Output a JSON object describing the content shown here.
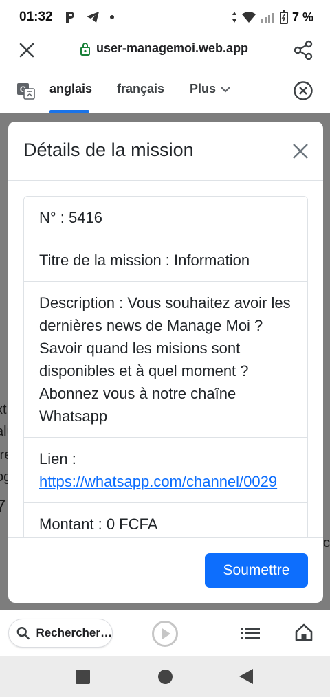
{
  "status": {
    "time": "01:32",
    "battery": "7 %"
  },
  "browser": {
    "url": "user-managemoi.web.app"
  },
  "translate": {
    "lang_active": "anglais",
    "lang_second": "français",
    "more": "Plus"
  },
  "background": {
    "fragments": [
      "xt",
      "alu",
      "tre",
      "og",
      "7",
      "c"
    ]
  },
  "modal": {
    "title": "Détails de la mission",
    "number": "N° : 5416",
    "mission_title": "Titre de la mission : Information",
    "description": "Description : Vous souhaitez avoir les dernières news de Manage Moi ? Savoir quand les misions sont disponibles et à quel moment ? Abonnez vous à notre chaîne Whatsapp",
    "link_label": "Lien :",
    "link_url": "https://whatsapp.com/channel/0029",
    "amount": "Montant : 0 FCFA",
    "submit": "Soumettre"
  },
  "toolbar": {
    "search": "Rechercher…"
  },
  "colors": {
    "accent": "#0d6efd",
    "translate_accent": "#1a73e8",
    "backdrop": "#7d7d7d"
  },
  "icons": [
    "signal-icon",
    "telegram-icon",
    "wifi-icon",
    "battery-icon",
    "lock-icon",
    "share-icon",
    "translate-icon",
    "close-icon",
    "search-icon",
    "play-icon",
    "list-icon",
    "home-icon"
  ]
}
